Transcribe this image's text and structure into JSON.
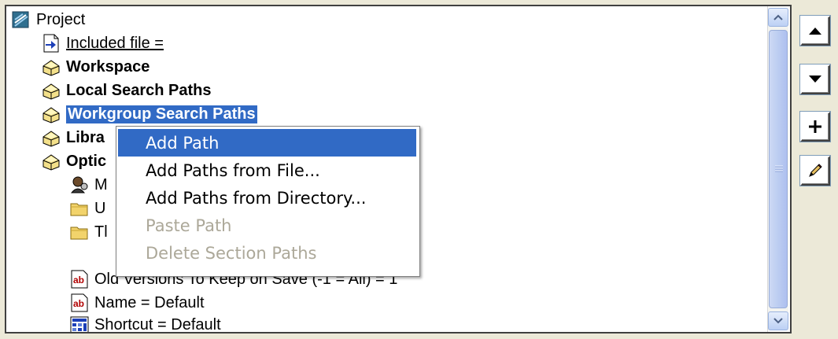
{
  "tree": {
    "items": [
      {
        "label": "Project",
        "icon": "project-icon"
      },
      {
        "label": "Included file =",
        "icon": "include-file-icon"
      },
      {
        "label": "Workspace",
        "icon": "section-icon"
      },
      {
        "label": "Local Search Paths",
        "icon": "section-icon"
      },
      {
        "label": "Workgroup Search Paths",
        "icon": "section-icon"
      },
      {
        "label": "Libra",
        "icon": "section-icon"
      },
      {
        "label": "Optic",
        "icon": "section-icon"
      },
      {
        "label": "M",
        "icon": "user-icon"
      },
      {
        "label": "U",
        "icon": "folder-icon"
      },
      {
        "label": "Tl",
        "icon": "folder-icon"
      },
      {
        "label": "Old Versions To Keep on Save (-1 = All) = 1",
        "icon": "text-value-icon"
      },
      {
        "label": "Name = Default",
        "icon": "text-value-icon"
      },
      {
        "label": "Shortcut = Default",
        "icon": "shortcut-icon"
      }
    ],
    "selected_index": 4
  },
  "context_menu": {
    "items": [
      {
        "label": "Add Path",
        "state": "highlighted"
      },
      {
        "label": "Add Paths from File...",
        "state": "enabled"
      },
      {
        "label": "Add Paths from Directory...",
        "state": "enabled"
      },
      {
        "label": "Paste Path",
        "state": "disabled"
      },
      {
        "label": "Delete Section Paths",
        "state": "disabled"
      }
    ]
  },
  "side_buttons": [
    {
      "name": "move-up-button",
      "icon": "triangle-up-icon"
    },
    {
      "name": "move-down-button",
      "icon": "triangle-down-icon"
    },
    {
      "name": "add-button",
      "icon": "plus-icon"
    },
    {
      "name": "edit-button",
      "icon": "pencil-icon"
    }
  ],
  "colors": {
    "selection": "#316ac5",
    "disabled_text": "#aca899",
    "window_bg": "#ece9d8"
  }
}
